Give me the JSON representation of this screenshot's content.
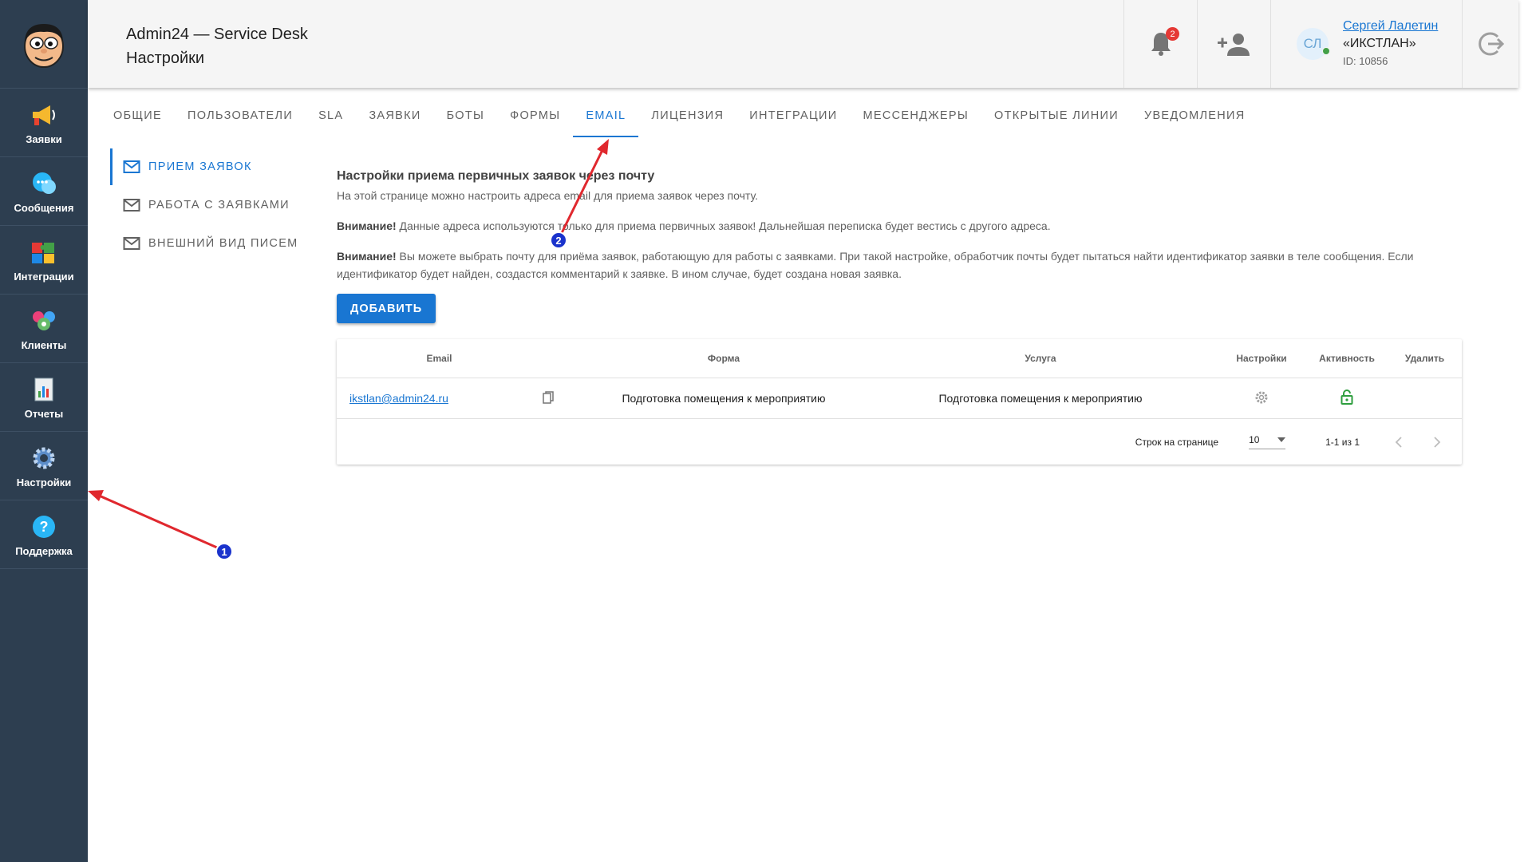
{
  "sidebar": {
    "items": [
      {
        "label": "Заявки",
        "icon": "megaphone-icon"
      },
      {
        "label": "Сообщения",
        "icon": "chat-bubbles-icon"
      },
      {
        "label": "Интеграции",
        "icon": "puzzle-icon"
      },
      {
        "label": "Клиенты",
        "icon": "people-icon"
      },
      {
        "label": "Отчеты",
        "icon": "report-icon"
      },
      {
        "label": "Настройки",
        "icon": "gear-icon"
      },
      {
        "label": "Поддержка",
        "icon": "question-icon"
      }
    ]
  },
  "header": {
    "app_title": "Admin24 — Service Desk",
    "page_title": "Настройки",
    "notifications_count": "2",
    "user": {
      "initials": "СЛ",
      "name": "Сергей Лалетин",
      "company": "«ИКСТЛАН»",
      "id": "ID: 10856"
    }
  },
  "tabs": [
    "ОБЩИЕ",
    "ПОЛЬЗОВАТЕЛИ",
    "SLA",
    "ЗАЯВКИ",
    "БОТЫ",
    "ФОРМЫ",
    "EMAIL",
    "ЛИЦЕНЗИЯ",
    "ИНТЕГРАЦИИ",
    "МЕССЕНДЖЕРЫ",
    "ОТКРЫТЫЕ ЛИНИИ",
    "УВЕДОМЛЕНИЯ"
  ],
  "active_tab": "EMAIL",
  "subnav": [
    {
      "label": "ПРИЕМ ЗАЯВОК",
      "active": true
    },
    {
      "label": "РАБОТА С ЗАЯВКАМИ",
      "active": false
    },
    {
      "label": "ВНЕШНИЙ ВИД ПИСЕМ",
      "active": false
    }
  ],
  "content": {
    "heading": "Настройки приема первичных заявок через почту",
    "description": "На этой странице можно настроить адреса email для приема заявок через почту.",
    "warning1_bold": "Внимание!",
    "warning1_text": " Данные адреса используются только для приема первичных заявок! Дальнейшая переписка будет вестись с другого адреса.",
    "warning2_bold": "Внимание!",
    "warning2_text": " Вы можете выбрать почту для приёма заявок, работающую для работы с заявками. При такой настройке, обработчик почты будет пытаться найти идентификатор заявки в теле сообщения. Если идентификатор будет найден, создастся комментарий к заявке. В ином случае, будет создана новая заявка.",
    "add_button": "ДОБАВИТЬ"
  },
  "table": {
    "headers": {
      "email": "Email",
      "form": "Форма",
      "service": "Услуга",
      "settings": "Настройки",
      "active": "Активность",
      "delete": "Удалить"
    },
    "rows": [
      {
        "email": "ikstlan@admin24.ru",
        "form": "Подготовка помещения к мероприятию",
        "service": "Подготовка помещения к мероприятию"
      }
    ],
    "footer": {
      "rows_per_page_label": "Строк на странице",
      "rows_per_page": "10",
      "range": "1-1 из 1"
    }
  },
  "annotations": {
    "marker1": "1",
    "marker2": "2"
  },
  "colors": {
    "sidebar": "#2d3e50",
    "accent": "#1976d2",
    "arrow": "#e0282e",
    "marker": "#1a33cc",
    "active_lock": "#2e9e3e"
  }
}
